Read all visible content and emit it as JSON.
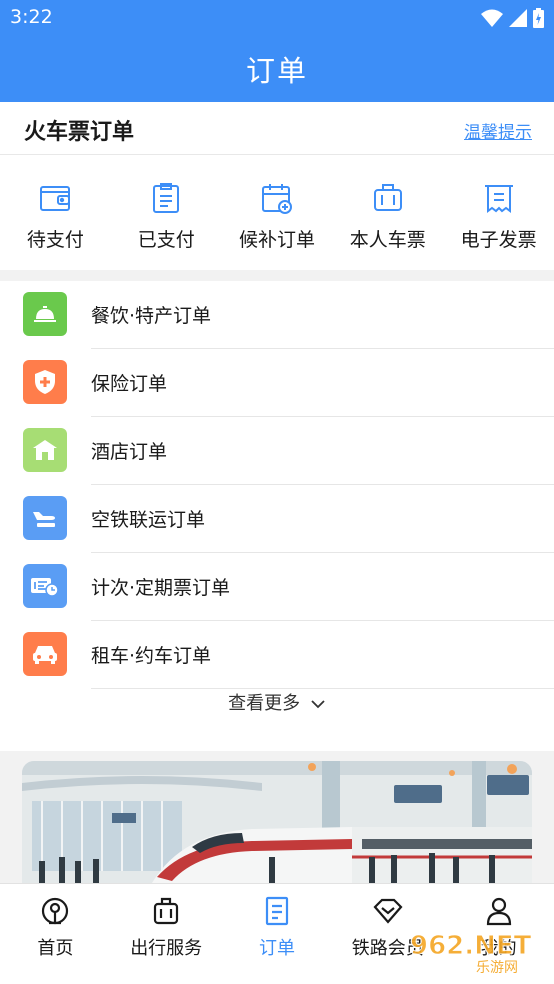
{
  "status_bar": {
    "time": "3:22"
  },
  "app_bar": {
    "title": "订单"
  },
  "section": {
    "title": "火车票订单",
    "tips_link": "温馨提示"
  },
  "quick_actions": [
    {
      "label": "待支付",
      "icon": "wallet-icon"
    },
    {
      "label": "已支付",
      "icon": "clipboard-icon"
    },
    {
      "label": "候补订单",
      "icon": "calendar-add-icon"
    },
    {
      "label": "本人车票",
      "icon": "luggage-icon"
    },
    {
      "label": "电子发票",
      "icon": "receipt-icon"
    }
  ],
  "orders": [
    {
      "label": "餐饮·特产订单",
      "icon": "dining-bell-icon",
      "color": "#6ac94c"
    },
    {
      "label": "保险订单",
      "icon": "shield-plus-icon",
      "color": "#ff7d4b"
    },
    {
      "label": "酒店订单",
      "icon": "hotel-icon",
      "color": "#a7dd74"
    },
    {
      "label": "空铁联运订单",
      "icon": "plane-train-icon",
      "color": "#5a9df4"
    },
    {
      "label": "计次·定期票订单",
      "icon": "ticket-clock-icon",
      "color": "#5a9df4"
    },
    {
      "label": "租车·约车订单",
      "icon": "car-icon",
      "color": "#ff7d4b"
    }
  ],
  "more": {
    "label": "查看更多"
  },
  "tabs": [
    {
      "label": "首页",
      "icon": "train-logo-icon"
    },
    {
      "label": "出行服务",
      "icon": "luggage-icon"
    },
    {
      "label": "订单",
      "icon": "order-document-icon"
    },
    {
      "label": "铁路会员",
      "icon": "diamond-icon"
    },
    {
      "label": "我的",
      "icon": "user-icon"
    }
  ],
  "watermark": {
    "text": "962.NET",
    "subtext": "乐游网"
  },
  "colors": {
    "primary": "#3d8ef7",
    "text": "#1a1a1a",
    "divider": "#e6e6e6"
  }
}
